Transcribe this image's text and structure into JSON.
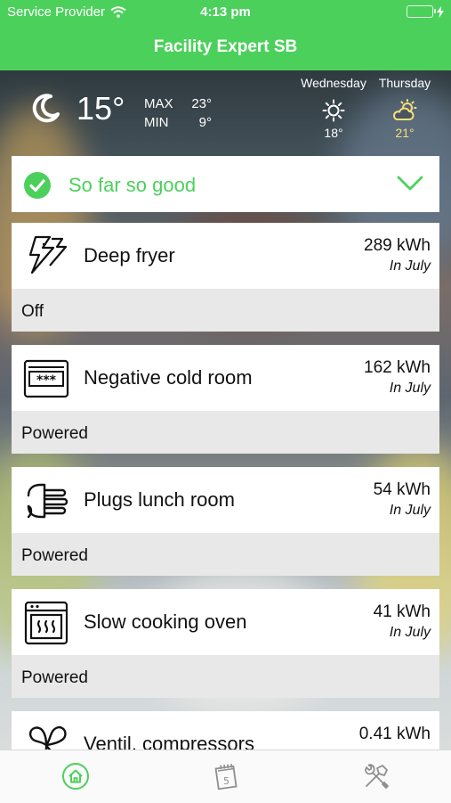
{
  "status_bar": {
    "carrier": "Service Provider",
    "time": "4:13 pm"
  },
  "nav": {
    "title": "Facility Expert SB"
  },
  "weather": {
    "current_temp": "15°",
    "max_label": "MAX",
    "max_value": "23°",
    "min_label": "MIN",
    "min_value": "9°",
    "forecast": [
      {
        "day": "Wednesday",
        "icon": "sun-icon",
        "temp": "18°"
      },
      {
        "day": "Thursday",
        "icon": "partly-cloudy-icon",
        "temp": "21°"
      }
    ]
  },
  "status_card": {
    "text": "So far so good"
  },
  "devices": [
    {
      "name": "Deep fryer",
      "kwh": "289 kWh",
      "period": "In July",
      "state": "Off",
      "icon": "lightning-icon"
    },
    {
      "name": "Negative cold room",
      "kwh": "162 kWh",
      "period": "In July",
      "state": "Powered",
      "icon": "cold-room-icon"
    },
    {
      "name": "Plugs lunch room",
      "kwh": "54 kWh",
      "period": "In July",
      "state": "Powered",
      "icon": "plug-icon"
    },
    {
      "name": "Slow cooking oven",
      "kwh": "41 kWh",
      "period": "In July",
      "state": "Powered",
      "icon": "oven-icon"
    },
    {
      "name": "Ventil. compressors",
      "kwh": "0.41 kWh",
      "period": "",
      "state": "",
      "icon": "fan-icon"
    }
  ],
  "tabbar": {
    "items": [
      {
        "icon": "home-icon",
        "active": true
      },
      {
        "icon": "calendar-icon",
        "badge": "5",
        "active": false
      },
      {
        "icon": "tools-icon",
        "active": false
      }
    ]
  },
  "colors": {
    "accent": "#4cd05c",
    "card": "#ffffff",
    "card_footer": "#e8e8e8"
  }
}
